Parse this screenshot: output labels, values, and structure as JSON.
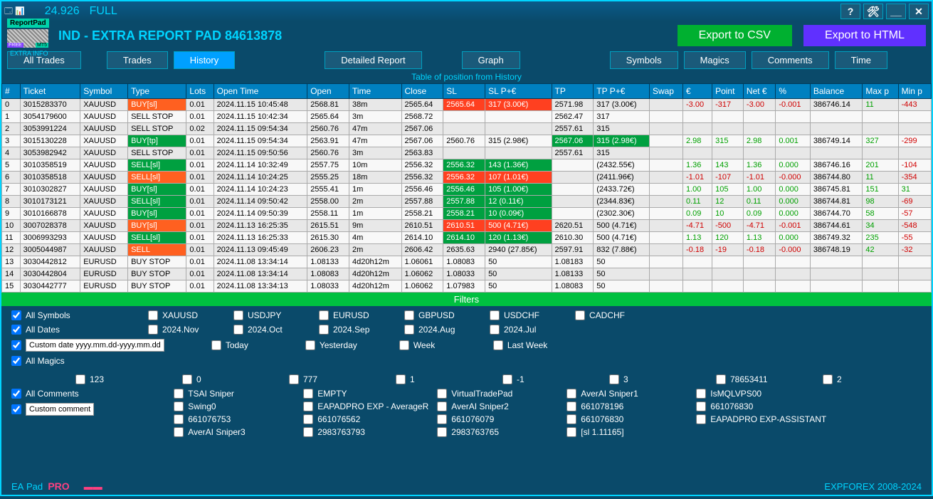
{
  "titlebar": {
    "version": "24.926",
    "mode": "FULL",
    "help": "?",
    "tools": "✖",
    "min": "__",
    "close": "✕"
  },
  "logo": {
    "badge": "ReportPad",
    "extra": "EXTRA INFO"
  },
  "header": {
    "title": "IND - EXTRA REPORT PAD 84613878",
    "csv": "Export to CSV",
    "html": "Export to HTML"
  },
  "tabs": {
    "all": "All Trades",
    "trades": "Trades",
    "history": "History",
    "report": "Detailed Report",
    "graph": "Graph",
    "symbols": "Symbols",
    "magics": "Magics",
    "comments": "Comments",
    "time": "Time"
  },
  "table_title": "Table of position from History",
  "columns": [
    "#",
    "Ticket",
    "Symbol",
    "Type",
    "Lots",
    "Open Time",
    "Open",
    "Time",
    "Close",
    "SL",
    "SL P+€",
    "TP",
    "TP P+€",
    "Swap",
    "€",
    "Point",
    "Net €",
    "%",
    "Balance",
    "Max p",
    "Min p"
  ],
  "rows": [
    {
      "n": "0",
      "ticket": "3015283370",
      "sym": "XAUUSD",
      "type": "BUY[sl]",
      "tc": "type-buysl",
      "lots": "0.01",
      "ot": "2024.11.15 10:45:48",
      "open": "2568.81",
      "time": "38m",
      "close": "2565.64",
      "sl": "2565.64",
      "slp": "317 (3.00€)",
      "slc": "red-cell",
      "tp": "2571.98",
      "tpp": "317 (3.00€)",
      "swap": "",
      "eur": "-3.00",
      "ec": "neg-num",
      "pt": "-317",
      "pc": "neg-num",
      "net": "-3.00",
      "nc": "neg-num",
      "pct": "-0.001",
      "pctc": "neg-num",
      "bal": "386746.14",
      "max": "11",
      "maxc": "pos-num",
      "min": "-443",
      "minc": "neg-num"
    },
    {
      "n": "1",
      "ticket": "3054179600",
      "sym": "XAUUSD",
      "type": "SELL STOP",
      "tc": "",
      "lots": "0.01",
      "ot": "2024.11.15 10:42:34",
      "open": "2565.64",
      "time": "3m",
      "close": "2568.72",
      "sl": "",
      "slp": "",
      "slc": "",
      "tp": "2562.47",
      "tpp": "317",
      "swap": "",
      "eur": "",
      "ec": "",
      "pt": "",
      "pc": "",
      "net": "",
      "nc": "",
      "pct": "",
      "pctc": "",
      "bal": "",
      "max": "",
      "maxc": "",
      "min": "",
      "minc": ""
    },
    {
      "n": "2",
      "ticket": "3053991224",
      "sym": "XAUUSD",
      "type": "SELL STOP",
      "tc": "",
      "lots": "0.02",
      "ot": "2024.11.15 09:54:34",
      "open": "2560.76",
      "time": "47m",
      "close": "2567.06",
      "sl": "",
      "slp": "",
      "slc": "",
      "tp": "2557.61",
      "tpp": "315",
      "swap": "",
      "eur": "",
      "ec": "",
      "pt": "",
      "pc": "",
      "net": "",
      "nc": "",
      "pct": "",
      "pctc": "",
      "bal": "",
      "max": "",
      "maxc": "",
      "min": "",
      "minc": ""
    },
    {
      "n": "3",
      "ticket": "3015130228",
      "sym": "XAUUSD",
      "type": "BUY[tp]",
      "tc": "type-buytp",
      "lots": "0.01",
      "ot": "2024.11.15 09:54:34",
      "open": "2563.91",
      "time": "47m",
      "close": "2567.06",
      "sl": "2560.76",
      "slp": "315 (2.98€)",
      "slc": "",
      "tp": "2567.06",
      "tpp": "315 (2.98€)",
      "tpc": "green-cell",
      "swap": "",
      "eur": "2.98",
      "ec": "pos-num",
      "pt": "315",
      "pc": "pos-num",
      "net": "2.98",
      "nc": "pos-num",
      "pct": "0.001",
      "pctc": "pos-num",
      "bal": "386749.14",
      "max": "327",
      "maxc": "pos-num",
      "min": "-299",
      "minc": "neg-num"
    },
    {
      "n": "4",
      "ticket": "3053982942",
      "sym": "XAUUSD",
      "type": "SELL STOP",
      "tc": "",
      "lots": "0.01",
      "ot": "2024.11.15 09:50:56",
      "open": "2560.76",
      "time": "3m",
      "close": "2563.83",
      "sl": "",
      "slp": "",
      "slc": "",
      "tp": "2557.61",
      "tpp": "315",
      "swap": "",
      "eur": "",
      "ec": "",
      "pt": "",
      "pc": "",
      "net": "",
      "nc": "",
      "pct": "",
      "pctc": "",
      "bal": "",
      "max": "",
      "maxc": "",
      "min": "",
      "minc": ""
    },
    {
      "n": "5",
      "ticket": "3010358519",
      "sym": "XAUUSD",
      "type": "SELL[sl]",
      "tc": "type-sellsl",
      "lots": "0.01",
      "ot": "2024.11.14 10:32:49",
      "open": "2557.75",
      "time": "10m",
      "close": "2556.32",
      "sl": "2556.32",
      "slp": "143 (1.36€)",
      "slc": "green-cell",
      "tp": "",
      "tpp": "(2432.55€)",
      "swap": "",
      "eur": "1.36",
      "ec": "pos-num",
      "pt": "143",
      "pc": "pos-num",
      "net": "1.36",
      "nc": "pos-num",
      "pct": "0.000",
      "pctc": "pos-num",
      "bal": "386746.16",
      "max": "201",
      "maxc": "pos-num",
      "min": "-104",
      "minc": "neg-num"
    },
    {
      "n": "6",
      "ticket": "3010358518",
      "sym": "XAUUSD",
      "type": "SELL[sl]",
      "tc": "type-sell",
      "lots": "0.01",
      "ot": "2024.11.14 10:24:25",
      "open": "2555.25",
      "time": "18m",
      "close": "2556.32",
      "sl": "2556.32",
      "slp": "107 (1.01€)",
      "slc": "red-cell",
      "tp": "",
      "tpp": "(2411.96€)",
      "swap": "",
      "eur": "-1.01",
      "ec": "neg-num",
      "pt": "-107",
      "pc": "neg-num",
      "net": "-1.01",
      "nc": "neg-num",
      "pct": "-0.000",
      "pctc": "neg-num",
      "bal": "386744.80",
      "max": "11",
      "maxc": "pos-num",
      "min": "-354",
      "minc": "neg-num"
    },
    {
      "n": "7",
      "ticket": "3010302827",
      "sym": "XAUUSD",
      "type": "BUY[sl]",
      "tc": "type-buytp",
      "lots": "0.01",
      "ot": "2024.11.14 10:24:23",
      "open": "2555.41",
      "time": "1m",
      "close": "2556.46",
      "sl": "2556.46",
      "slp": "105 (1.00€)",
      "slc": "green-cell",
      "tp": "",
      "tpp": "(2433.72€)",
      "swap": "",
      "eur": "1.00",
      "ec": "pos-num",
      "pt": "105",
      "pc": "pos-num",
      "net": "1.00",
      "nc": "pos-num",
      "pct": "0.000",
      "pctc": "pos-num",
      "bal": "386745.81",
      "max": "151",
      "maxc": "pos-num",
      "min": "31",
      "minc": "pos-num"
    },
    {
      "n": "8",
      "ticket": "3010173121",
      "sym": "XAUUSD",
      "type": "SELL[sl]",
      "tc": "type-sellsl",
      "lots": "0.01",
      "ot": "2024.11.14 09:50:42",
      "open": "2558.00",
      "time": "2m",
      "close": "2557.88",
      "sl": "2557.88",
      "slp": "12 (0.11€)",
      "slc": "green-cell",
      "tp": "",
      "tpp": "(2344.83€)",
      "swap": "",
      "eur": "0.11",
      "ec": "pos-num",
      "pt": "12",
      "pc": "pos-num",
      "net": "0.11",
      "nc": "pos-num",
      "pct": "0.000",
      "pctc": "pos-num",
      "bal": "386744.81",
      "max": "98",
      "maxc": "pos-num",
      "min": "-69",
      "minc": "neg-num"
    },
    {
      "n": "9",
      "ticket": "3010166878",
      "sym": "XAUUSD",
      "type": "BUY[sl]",
      "tc": "type-buytp",
      "lots": "0.01",
      "ot": "2024.11.14 09:50:39",
      "open": "2558.11",
      "time": "1m",
      "close": "2558.21",
      "sl": "2558.21",
      "slp": "10 (0.09€)",
      "slc": "green-cell",
      "tp": "",
      "tpp": "(2302.30€)",
      "swap": "",
      "eur": "0.09",
      "ec": "pos-num",
      "pt": "10",
      "pc": "pos-num",
      "net": "0.09",
      "nc": "pos-num",
      "pct": "0.000",
      "pctc": "pos-num",
      "bal": "386744.70",
      "max": "58",
      "maxc": "pos-num",
      "min": "-57",
      "minc": "neg-num"
    },
    {
      "n": "10",
      "ticket": "3007028378",
      "sym": "XAUUSD",
      "type": "BUY[sl]",
      "tc": "type-buysl",
      "lots": "0.01",
      "ot": "2024.11.13 16:25:35",
      "open": "2615.51",
      "time": "9m",
      "close": "2610.51",
      "sl": "2610.51",
      "slp": "500 (4.71€)",
      "slc": "red-cell",
      "tp": "2620.51",
      "tpp": "500 (4.71€)",
      "swap": "",
      "eur": "-4.71",
      "ec": "neg-num",
      "pt": "-500",
      "pc": "neg-num",
      "net": "-4.71",
      "nc": "neg-num",
      "pct": "-0.001",
      "pctc": "neg-num",
      "bal": "386744.61",
      "max": "34",
      "maxc": "pos-num",
      "min": "-548",
      "minc": "neg-num"
    },
    {
      "n": "11",
      "ticket": "3006993293",
      "sym": "XAUUSD",
      "type": "SELL[sl]",
      "tc": "type-sellsl",
      "lots": "0.01",
      "ot": "2024.11.13 16:25:33",
      "open": "2615.30",
      "time": "4m",
      "close": "2614.10",
      "sl": "2614.10",
      "slp": "120 (1.13€)",
      "slc": "green-cell",
      "tp": "2610.30",
      "tpp": "500 (4.71€)",
      "swap": "",
      "eur": "1.13",
      "ec": "pos-num",
      "pt": "120",
      "pc": "pos-num",
      "net": "1.13",
      "nc": "pos-num",
      "pct": "0.000",
      "pctc": "pos-num",
      "bal": "386749.32",
      "max": "235",
      "maxc": "pos-num",
      "min": "-55",
      "minc": "neg-num"
    },
    {
      "n": "12",
      "ticket": "3005044987",
      "sym": "XAUUSD",
      "type": "SELL",
      "tc": "type-sell",
      "lots": "0.01",
      "ot": "2024.11.13 09:45:49",
      "open": "2606.23",
      "time": "2m",
      "close": "2606.42",
      "sl": "2635.63",
      "slp": "2940 (27.85€)",
      "slc": "",
      "tp": "2597.91",
      "tpp": "832 (7.88€)",
      "swap": "",
      "eur": "-0.18",
      "ec": "neg-num",
      "pt": "-19",
      "pc": "neg-num",
      "net": "-0.18",
      "nc": "neg-num",
      "pct": "-0.000",
      "pctc": "neg-num",
      "bal": "386748.19",
      "max": "42",
      "maxc": "pos-num",
      "min": "-32",
      "minc": "neg-num"
    },
    {
      "n": "13",
      "ticket": "3030442812",
      "sym": "EURUSD",
      "type": "BUY STOP",
      "tc": "",
      "lots": "0.01",
      "ot": "2024.11.08 13:34:14",
      "open": "1.08133",
      "time": "4d20h12m",
      "close": "1.06061",
      "sl": "1.08083",
      "slp": "50",
      "slc": "",
      "tp": "1.08183",
      "tpp": "50",
      "swap": "",
      "eur": "",
      "ec": "",
      "pt": "",
      "pc": "",
      "net": "",
      "nc": "",
      "pct": "",
      "pctc": "",
      "bal": "",
      "max": "",
      "maxc": "",
      "min": "",
      "minc": ""
    },
    {
      "n": "14",
      "ticket": "3030442804",
      "sym": "EURUSD",
      "type": "BUY STOP",
      "tc": "",
      "lots": "0.01",
      "ot": "2024.11.08 13:34:14",
      "open": "1.08083",
      "time": "4d20h12m",
      "close": "1.06062",
      "sl": "1.08033",
      "slp": "50",
      "slc": "",
      "tp": "1.08133",
      "tpp": "50",
      "swap": "",
      "eur": "",
      "ec": "",
      "pt": "",
      "pc": "",
      "net": "",
      "nc": "",
      "pct": "",
      "pctc": "",
      "bal": "",
      "max": "",
      "maxc": "",
      "min": "",
      "minc": ""
    },
    {
      "n": "15",
      "ticket": "3030442777",
      "sym": "EURUSD",
      "type": "BUY STOP",
      "tc": "",
      "lots": "0.01",
      "ot": "2024.11.08 13:34:13",
      "open": "1.08033",
      "time": "4d20h12m",
      "close": "1.06062",
      "sl": "1.07983",
      "slp": "50",
      "slc": "",
      "tp": "1.08083",
      "tpp": "50",
      "swap": "",
      "eur": "",
      "ec": "",
      "pt": "",
      "pc": "",
      "net": "",
      "nc": "",
      "pct": "",
      "pctc": "",
      "bal": "",
      "max": "",
      "maxc": "",
      "min": "",
      "minc": ""
    }
  ],
  "filters": {
    "title": "Filters",
    "all_symbols": "All Symbols",
    "symbols": [
      "XAUUSD",
      "USDJPY",
      "EURUSD",
      "GBPUSD",
      "USDCHF",
      "CADCHF"
    ],
    "all_dates": "All Dates",
    "dates": [
      "2024.Nov",
      "2024.Oct",
      "2024.Sep",
      "2024.Aug",
      "2024.Jul"
    ],
    "custom_date": "Custom date yyyy.mm.dd-yyyy.mm.dd",
    "date_rel": [
      "Today",
      "Yesterday",
      "Week",
      "Last Week"
    ],
    "all_magics": "All Magics",
    "magics": [
      "123",
      "0",
      "777",
      "1",
      "-1",
      "3",
      "78653411",
      "2"
    ],
    "all_comments": "All Comments",
    "custom_comment": "Custom comment",
    "comments1": [
      "TSAI Sniper",
      "Swing0",
      "661076753",
      "AverAI Sniper3"
    ],
    "comments2": [
      "EMPTY",
      "EAPADPRO EXP - AverageR",
      "661076562",
      "2983763793"
    ],
    "comments3": [
      "VirtualTradePad",
      "AverAI Sniper2",
      "661076079",
      "2983763765"
    ],
    "comments4": [
      "AverAI Sniper1",
      "661078196",
      "661076830",
      "[sl 1.11165]"
    ],
    "comments5": [
      "IsMQLVPS00",
      "661076830",
      "EAPADPRO EXP-ASSISTANT"
    ]
  },
  "footer": {
    "ea": "EA",
    "pad": "Pad",
    "pro": "PRO",
    "copy": "EXPFOREX 2008-2024"
  }
}
